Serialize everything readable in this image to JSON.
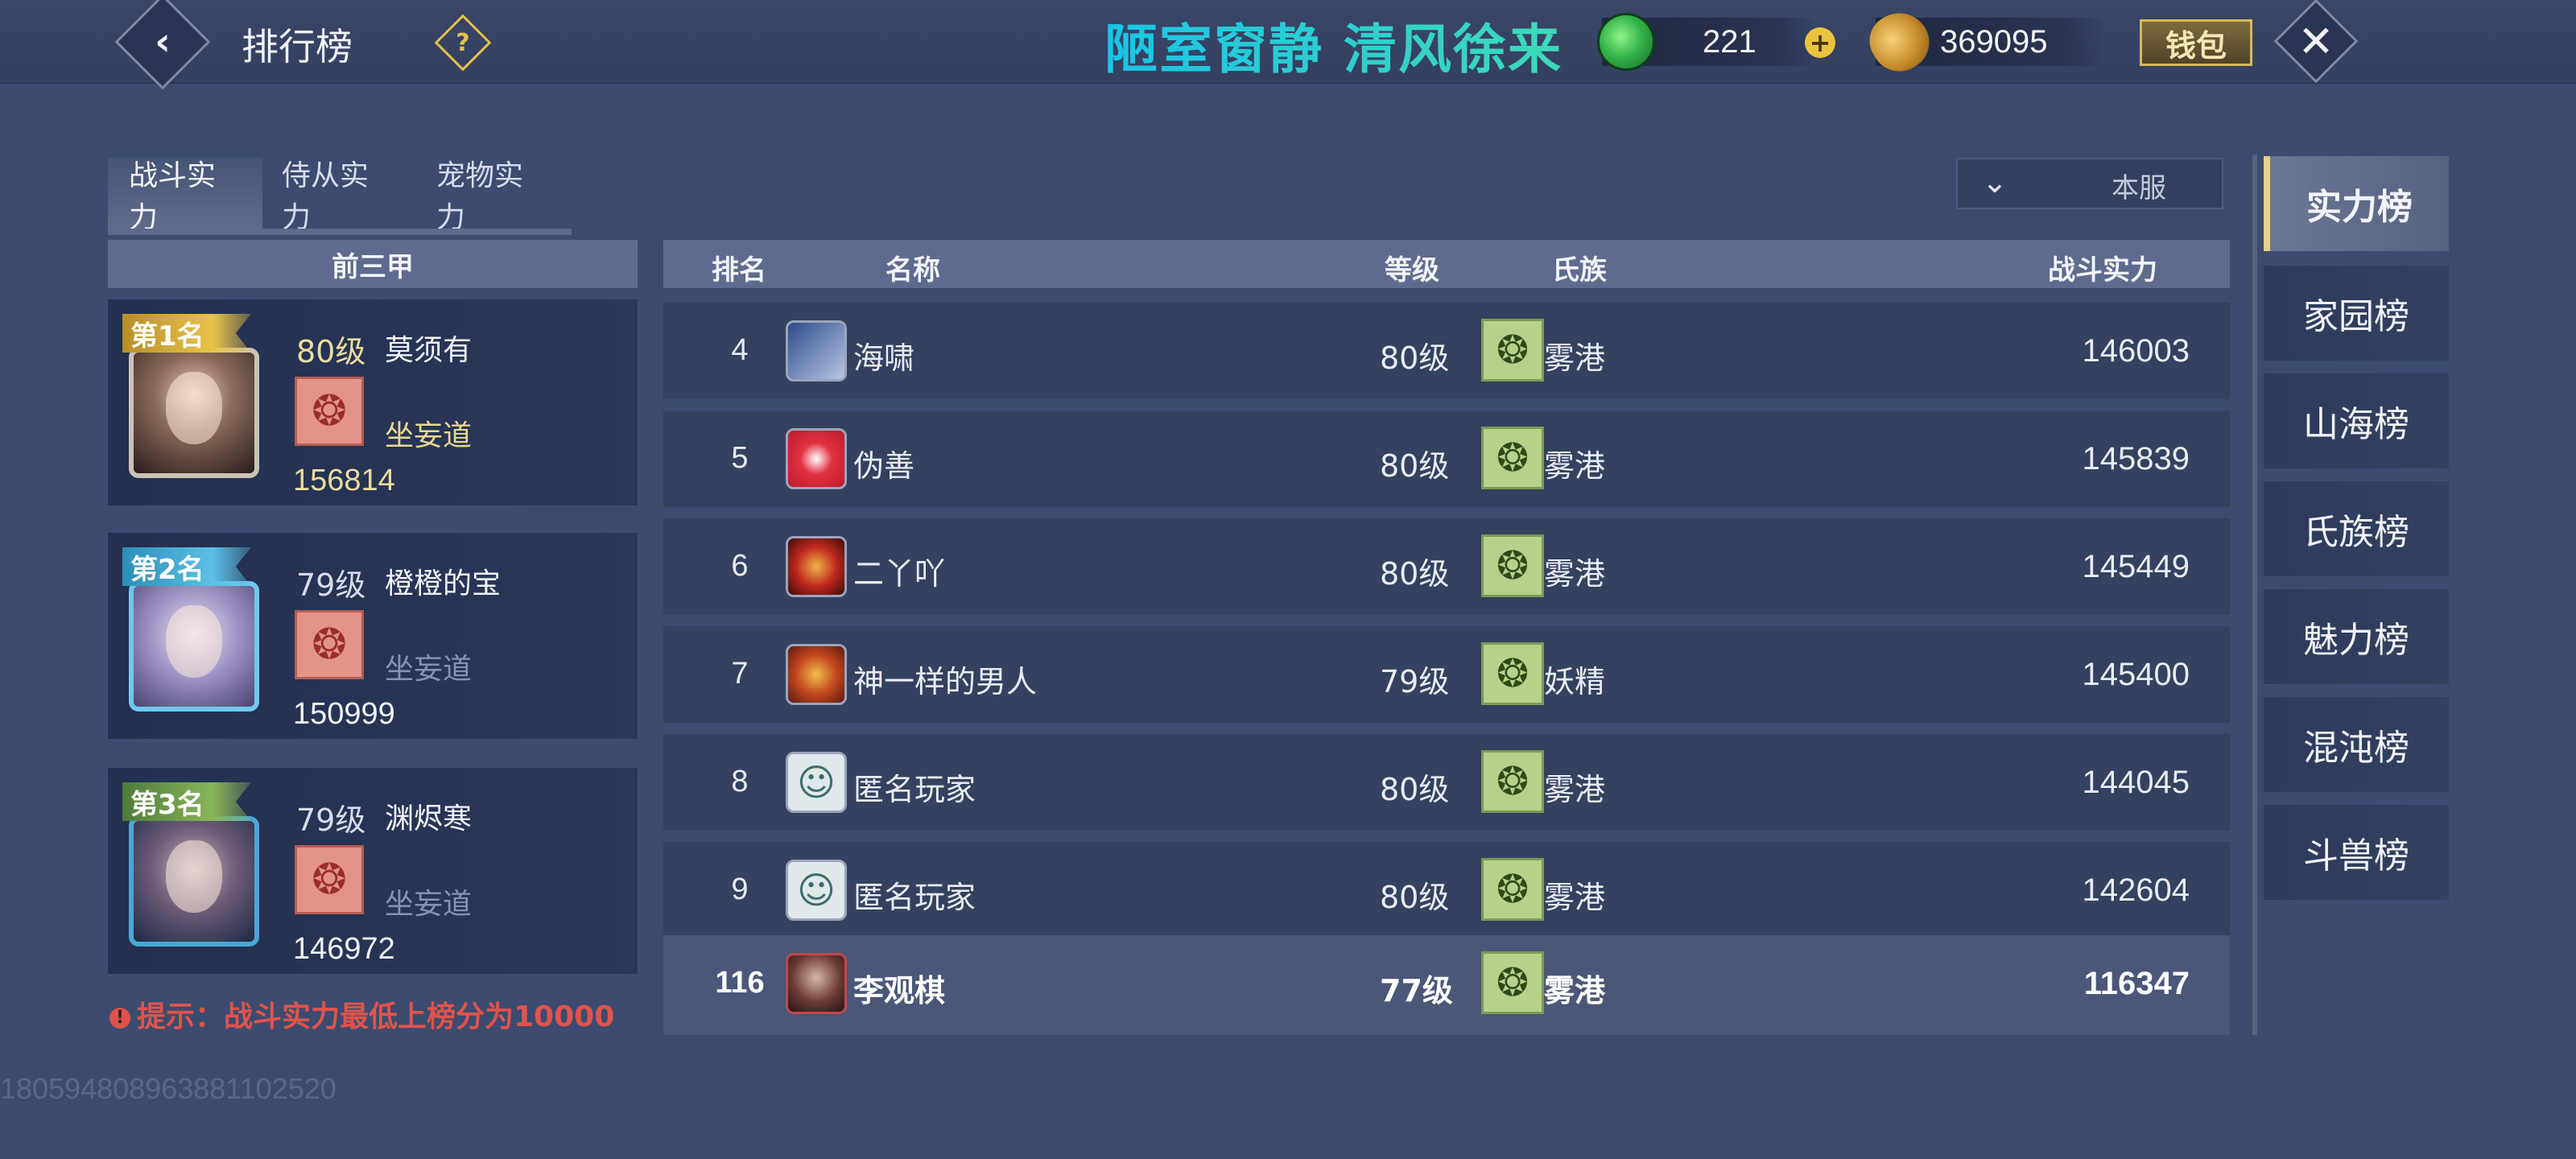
{
  "header": {
    "title": "排行榜",
    "help_icon": "question-icon",
    "slogan": "陋室窗静 清风徐来",
    "currency_jade": "221",
    "currency_coin": "369095",
    "wallet_label": "钱包"
  },
  "tabs": [
    {
      "label": "战斗实力",
      "active": true
    },
    {
      "label": "侍从实力",
      "active": false
    },
    {
      "label": "宠物实力",
      "active": false
    }
  ],
  "server_select": {
    "value": "本服"
  },
  "top3": {
    "header": "前三甲",
    "items": [
      {
        "rank": "第1名",
        "level": "80级",
        "name": "莫须有",
        "clan": "坐妄道",
        "power": "156814"
      },
      {
        "rank": "第2名",
        "level": "79级",
        "name": "橙橙的宝",
        "clan": "坐妄道",
        "power": "150999"
      },
      {
        "rank": "第3名",
        "level": "79级",
        "name": "渊烬寒",
        "clan": "坐妄道",
        "power": "146972"
      }
    ]
  },
  "tip": "提示：战斗实力最低上榜分为10000",
  "uid": "180594808963881102520",
  "table": {
    "headers": {
      "rank": "排名",
      "name": "名称",
      "level": "等级",
      "clan": "氏族",
      "power": "战斗实力"
    },
    "rows": [
      {
        "rank": "4",
        "name": "海啸",
        "level": "80级",
        "clan": "雾港",
        "power": "146003"
      },
      {
        "rank": "5",
        "name": "伪善",
        "level": "80级",
        "clan": "雾港",
        "power": "145839"
      },
      {
        "rank": "6",
        "name": "二丫吖",
        "level": "80级",
        "clan": "雾港",
        "power": "145449"
      },
      {
        "rank": "7",
        "name": "神一样的男人",
        "level": "79级",
        "clan": "妖精",
        "power": "145400"
      },
      {
        "rank": "8",
        "name": "匿名玩家",
        "level": "80级",
        "clan": "雾港",
        "power": "144045"
      },
      {
        "rank": "9",
        "name": "匿名玩家",
        "level": "80级",
        "clan": "雾港",
        "power": "142604"
      }
    ],
    "me": {
      "rank": "116",
      "name": "李观棋",
      "level": "77级",
      "clan": "雾港",
      "power": "116347"
    }
  },
  "boards": [
    {
      "label": "实力榜",
      "active": true
    },
    {
      "label": "家园榜",
      "active": false
    },
    {
      "label": "山海榜",
      "active": false
    },
    {
      "label": "氏族榜",
      "active": false
    },
    {
      "label": "魅力榜",
      "active": false
    },
    {
      "label": "混沌榜",
      "active": false
    },
    {
      "label": "斗兽榜",
      "active": false
    }
  ],
  "colors": {
    "background": "#3c4b6f",
    "accent_gold": "#e6d08a",
    "tip_red": "#e0534a",
    "slogan_cyan": "#19c4e8"
  }
}
